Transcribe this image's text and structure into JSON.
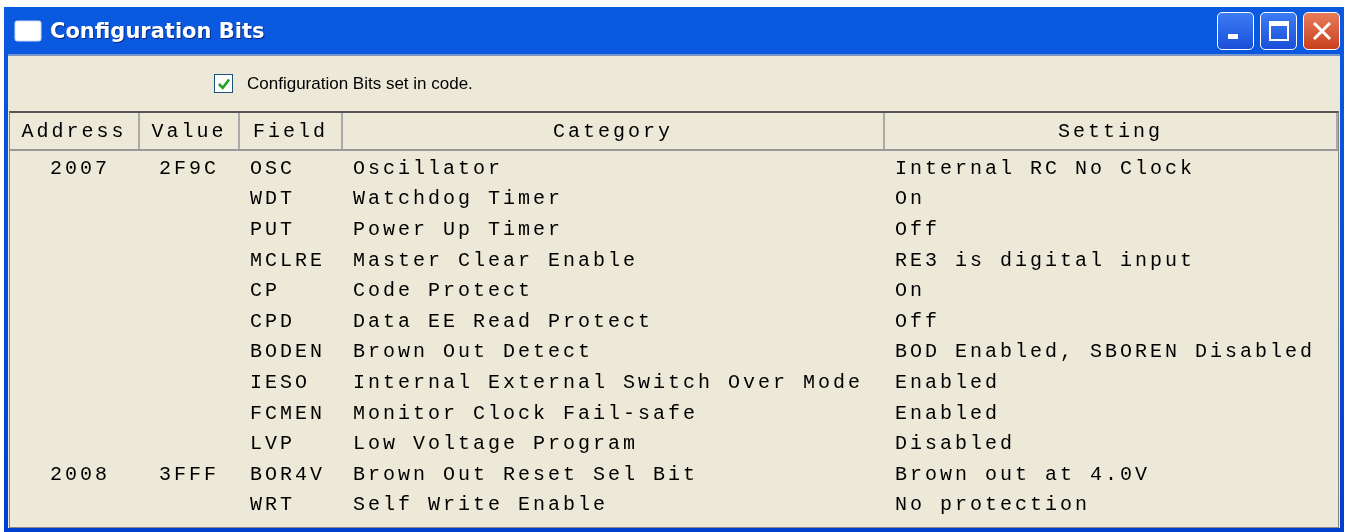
{
  "window": {
    "title": "Configuration Bits"
  },
  "set_in_code": {
    "label": "Configuration Bits set in code.",
    "checked": true
  },
  "table": {
    "columns": [
      "Address",
      "Value",
      "Field",
      "Category",
      "Setting"
    ],
    "rows": [
      {
        "address": "2007",
        "value": "2F9C",
        "field": "OSC",
        "category": "Oscillator",
        "setting": "Internal RC No Clock"
      },
      {
        "field": "WDT",
        "category": "Watchdog Timer",
        "setting": "On"
      },
      {
        "field": "PUT",
        "category": "Power Up Timer",
        "setting": "Off"
      },
      {
        "field": "MCLRE",
        "category": "Master Clear Enable",
        "setting": "RE3 is digital input"
      },
      {
        "field": "CP",
        "category": "Code Protect",
        "setting": "On"
      },
      {
        "field": "CPD",
        "category": "Data EE Read Protect",
        "setting": "Off"
      },
      {
        "field": "BODEN",
        "category": "Brown Out Detect",
        "setting": "BOD Enabled, SBOREN Disabled"
      },
      {
        "field": "IESO",
        "category": "Internal External Switch Over Mode",
        "setting": "Enabled"
      },
      {
        "field": "FCMEN",
        "category": "Monitor Clock Fail-safe",
        "setting": "Enabled"
      },
      {
        "field": "LVP",
        "category": "Low Voltage Program",
        "setting": "Disabled"
      },
      {
        "address": "2008",
        "value": "3FFF",
        "field": "BOR4V",
        "category": "Brown Out Reset Sel Bit",
        "setting": "Brown out at 4.0V"
      },
      {
        "field": "WRT",
        "category": "Self Write Enable",
        "setting": "No protection"
      }
    ]
  }
}
